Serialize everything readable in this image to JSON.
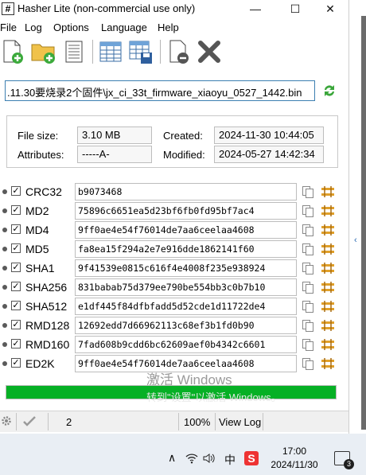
{
  "window": {
    "icon": "#",
    "title": "Hasher Lite (non-commercial use only)",
    "controls": {
      "minimize": "—",
      "maximize": "☐",
      "close": "✕"
    }
  },
  "menu": [
    "File",
    "Log",
    "Options",
    "Language",
    "Help"
  ],
  "toolbar": {
    "buttons": [
      "add-file-icon",
      "add-folder-icon",
      "document-icon",
      "table-icon",
      "save-table-icon",
      "remove-file-icon",
      "delete-x-icon"
    ]
  },
  "file": {
    "path": ".11.30要烧录2个固件\\jx_ci_33t_firmware_xiaoyu_0527_1442.bin",
    "size_label": "File size:",
    "size_value": "3.10 MB",
    "attributes_label": "Attributes:",
    "attributes_value": "-----A-",
    "created_label": "Created:",
    "created_value": "2024-11-30 10:44:05",
    "modified_label": "Modified:",
    "modified_value": "2024-05-27 14:42:34"
  },
  "hashes": [
    {
      "name": "CRC32",
      "value": "b9073468"
    },
    {
      "name": "MD2",
      "value": "75896c6651ea5d23bf6fb0fd95bf7ac4"
    },
    {
      "name": "MD4",
      "value": "9ff0ae4e54f76014de7aa6ceelaa4608"
    },
    {
      "name": "MD5",
      "value": "fa8ea15f294a2e7e916dde1862141f60"
    },
    {
      "name": "SHA1",
      "value": "9f41539e0815c616f4e4008f235e938924"
    },
    {
      "name": "SHA256",
      "value": "831babab75d379ee790be554bb3c0b7b10"
    },
    {
      "name": "SHA512",
      "value": "e1df445f84dfbfadd5d52cde1d11722de4"
    },
    {
      "name": "RMD128",
      "value": "12692edd7d66962113c68ef3b1fd0b90"
    },
    {
      "name": "RMD160",
      "value": "7fad608b9cdd6bc62609aef0b4342c6601"
    },
    {
      "name": "ED2K",
      "value": "9ff0ae4e54f76014de7aa6ceelaa4608"
    }
  ],
  "progress": {
    "fraction": 1.0,
    "color": "#06b025"
  },
  "watermark": {
    "line1": "激活 Windows",
    "line2": "转到\"设置\"以激活 Windows。"
  },
  "status": {
    "count": "2",
    "zoom": "100%",
    "view_log": "View Log"
  },
  "taskbar": {
    "time": "17:00",
    "date": "2024/11/30",
    "ime": "中",
    "notifications": "3"
  }
}
